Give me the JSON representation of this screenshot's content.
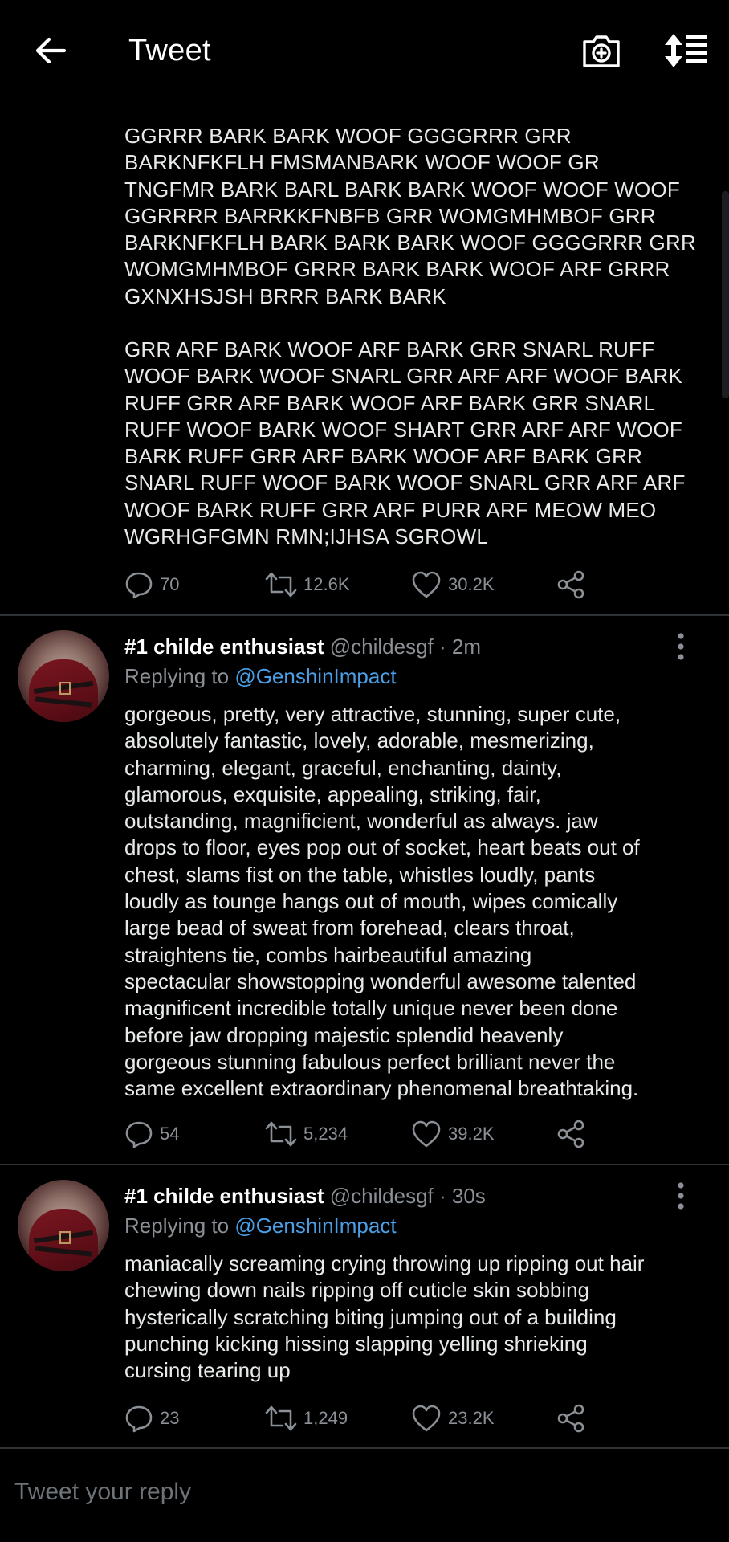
{
  "header": {
    "title": "Tweet",
    "back_icon": "arrow-left-icon",
    "camera_icon": "camera-plus-icon",
    "sort_icon": "sort-list-icon"
  },
  "main_tweet": {
    "paragraph1": "GGRRR BARK BARK WOOF GGGGRRR GRR\nBARKNFKFLH FMSMANBARK WOOF WOOF GR\nTNGFMR BARK BARL BARK BARK WOOF WOOF WOOF\nGGRRRR BARRKKFNBFB GRR WOMGMHMBOF GRR\nBARKNFKFLH BARK BARK BARK WOOF GGGGRRR GRR\nWOMGMHMBOF GRRR BARK BARK WOOF ARF GRRR\nGXNXHSJSH BRRR BARK BARK",
    "paragraph2": "GRR ARF BARK WOOF ARF BARK GRR SNARL RUFF\nWOOF BARK WOOF SNARL GRR ARF ARF WOOF BARK\nRUFF GRR ARF BARK WOOF ARF BARK GRR SNARL\nRUFF WOOF BARK WOOF SHART GRR ARF ARF WOOF\nBARK RUFF GRR ARF BARK WOOF ARF BARK GRR\nSNARL RUFF WOOF BARK WOOF SNARL GRR ARF ARF\nWOOF BARK RUFF GRR ARF PURR ARF MEOW MEO\nWGRHGFGMN RMN;IJHSA SGROWL",
    "stats": {
      "replies": "70",
      "retweets": "12.6K",
      "likes": "30.2K"
    }
  },
  "replies": [
    {
      "name": "#1 childe enthusiast",
      "handle": "@childesgf",
      "time": " · 2m",
      "replying_label": "Replying to ",
      "replying_to": "@GenshinImpact",
      "text": "gorgeous, pretty, very attractive, stunning, super cute,\nabsolutely fantastic, lovely, adorable, mesmerizing,\ncharming, elegant, graceful, enchanting, dainty,\nglamorous, exquisite, appealing, striking, fair,\noutstanding, magnificient, wonderful as always. jaw\ndrops to floor, eyes pop out of socket, heart beats out of\nchest, slams fist on the table, whistles loudly, pants\nloudly as tounge hangs out of mouth, wipes comically\nlarge bead of sweat from forehead, clears throat,\nstraightens tie, combs hairbeautiful amazing\nspectacular showstopping wonderful awesome talented\nmagnificent incredible totally unique never been done\nbefore jaw dropping majestic splendid heavenly\ngorgeous stunning fabulous perfect brilliant never the\nsame excellent extraordinary phenomenal breathtaking.",
      "stats": {
        "replies": "54",
        "retweets": "5,234",
        "likes": "39.2K"
      }
    },
    {
      "name": "#1 childe enthusiast",
      "handle": "@childesgf",
      "time": " · 30s",
      "replying_label": "Replying to ",
      "replying_to": "@GenshinImpact",
      "text": "maniacally screaming crying throwing up ripping out hair\nchewing down nails ripping off cuticle skin sobbing\nhysterically scratching biting jumping out of a building\npunching kicking hissing slapping yelling shrieking\ncursing tearing up",
      "stats": {
        "replies": "23",
        "retweets": "1,249",
        "likes": "23.2K"
      }
    }
  ],
  "composer": {
    "placeholder": "Tweet your reply"
  },
  "colors": {
    "background": "#000000",
    "text": "#e7e9ea",
    "muted": "#8b9096",
    "link": "#4a9fe6",
    "divider": "#2f3336"
  }
}
